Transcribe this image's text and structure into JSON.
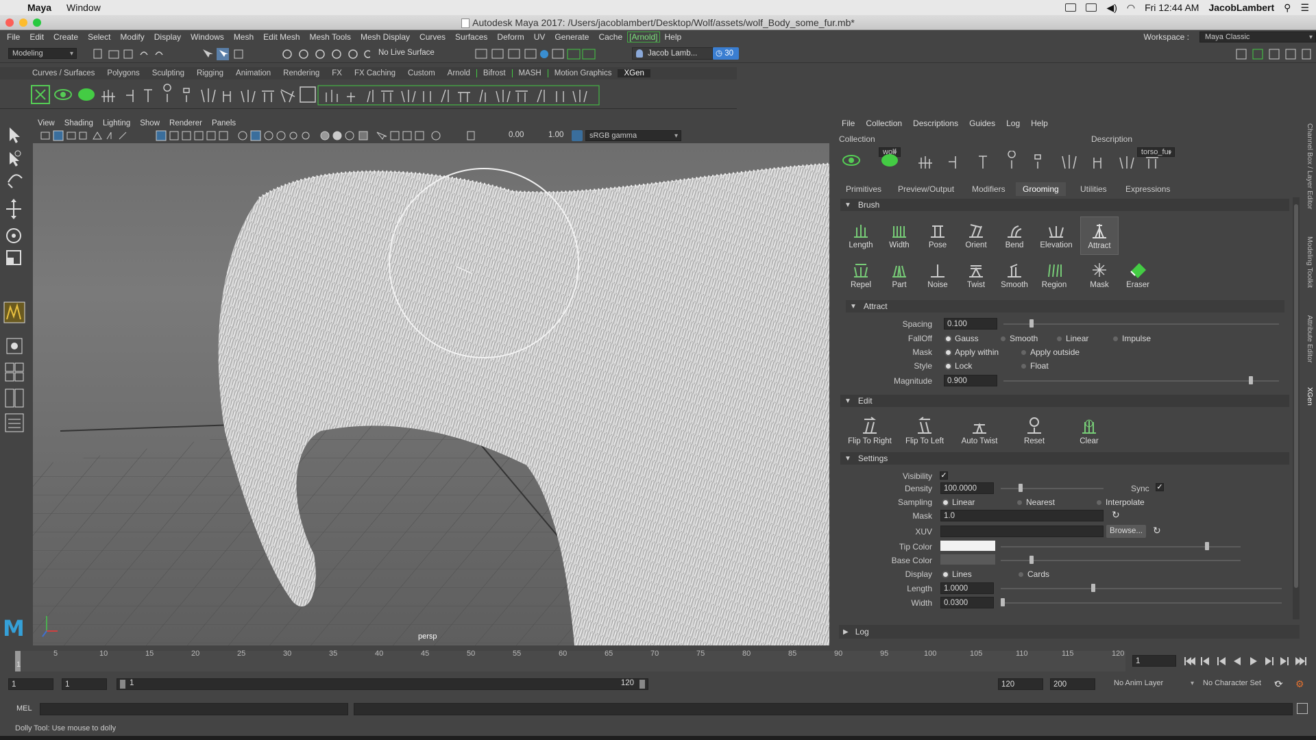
{
  "mac": {
    "app": "Maya",
    "menu": [
      "Window"
    ],
    "time": "Fri 12:44 AM",
    "user": "JacobLambert"
  },
  "window_title": "Autodesk Maya 2017: /Users/jacoblambert/Desktop/Wolf/assets/wolf_Body_some_fur.mb*",
  "menubar": [
    "File",
    "Edit",
    "Create",
    "Select",
    "Modify",
    "Display",
    "Windows",
    "Mesh",
    "Edit Mesh",
    "Mesh Tools",
    "Mesh Display",
    "Curves",
    "Surfaces",
    "Deform",
    "UV",
    "Generate",
    "Cache",
    "[Arnold]",
    "Help"
  ],
  "workspace": {
    "label": "Workspace :",
    "value": "Maya Classic"
  },
  "status": {
    "mode": "Modeling",
    "live_surface": "No Live Surface",
    "user": "Jacob Lamb...",
    "notifications": "30"
  },
  "shelf_tabs": [
    "Curves / Surfaces",
    "Polygons",
    "Sculpting",
    "Rigging",
    "Animation",
    "Rendering",
    "FX",
    "FX Caching",
    "Custom",
    "Arnold",
    "Bifrost",
    "MASH",
    "Motion Graphics",
    "XGen"
  ],
  "shelf_active": "XGen",
  "viewport": {
    "menu": [
      "View",
      "Shading",
      "Lighting",
      "Show",
      "Renderer",
      "Panels"
    ],
    "field1": "0.00",
    "field2": "1.00",
    "color_space": "sRGB gamma",
    "camera": "persp"
  },
  "xgen": {
    "menu": [
      "File",
      "Collection",
      "Descriptions",
      "Guides",
      "Log",
      "Help"
    ],
    "collection_label": "Collection",
    "collection": "wolf",
    "description_label": "Description",
    "description": "torso_fur",
    "tabs": [
      "Primitives",
      "Preview/Output",
      "Modifiers",
      "Grooming",
      "Utilities",
      "Expressions"
    ],
    "active_tab": "Grooming",
    "brush_section": "Brush",
    "brushes_row1": [
      "Length",
      "Width",
      "Pose",
      "Orient",
      "Bend",
      "Elevation",
      "Attract"
    ],
    "brushes_row2": [
      "Repel",
      "Part",
      "Noise",
      "Twist",
      "Smooth",
      "Region",
      "Mask",
      "Eraser"
    ],
    "active_brush": "Attract",
    "attract": {
      "title": "Attract",
      "spacing_label": "Spacing",
      "spacing": "0.100",
      "falloff_label": "FallOff",
      "falloff_options": [
        "Gauss",
        "Smooth",
        "Linear",
        "Impulse"
      ],
      "mask_label": "Mask",
      "mask_options": [
        "Apply within",
        "Apply outside"
      ],
      "style_label": "Style",
      "style_options": [
        "Lock",
        "Float"
      ],
      "magnitude_label": "Magnitude",
      "magnitude": "0.900"
    },
    "edit": {
      "title": "Edit",
      "buttons": [
        "Flip To Right",
        "Flip To Left",
        "Auto Twist",
        "Reset",
        "Clear"
      ]
    },
    "settings": {
      "title": "Settings",
      "visibility_label": "Visibility",
      "density_label": "Density",
      "density": "100.0000",
      "sync_label": "Sync",
      "sampling_label": "Sampling",
      "sampling_options": [
        "Linear",
        "Nearest",
        "Interpolate"
      ],
      "mask_label": "Mask",
      "mask": "1.0",
      "xuv_label": "XUV",
      "browse": "Browse...",
      "tip_color_label": "Tip Color",
      "base_color_label": "Base Color",
      "display_label": "Display",
      "display_options": [
        "Lines",
        "Cards"
      ],
      "length_label": "Length",
      "length": "1.0000",
      "width_label": "Width",
      "width": "0.0300"
    },
    "log": "Log"
  },
  "side_tabs": [
    "Channel Box / Layer Editor",
    "Modeling Toolkit",
    "Attribute Editor",
    "XGen"
  ],
  "timeline": {
    "ticks": [
      "1",
      "5",
      "10",
      "15",
      "20",
      "25",
      "30",
      "35",
      "40",
      "45",
      "50",
      "55",
      "60",
      "65",
      "70",
      "75",
      "80",
      "85",
      "90",
      "95",
      "100",
      "105",
      "110",
      "115",
      "120"
    ],
    "current": "1"
  },
  "range": {
    "start": "1",
    "inner_start": "1",
    "slider_start": "1",
    "slider_end": "120",
    "end": "120",
    "outer_end": "200",
    "anim_layer": "No Anim Layer",
    "char_set": "No Character Set"
  },
  "cmd": {
    "label": "MEL"
  },
  "help": "Dolly Tool: Use mouse to dolly"
}
